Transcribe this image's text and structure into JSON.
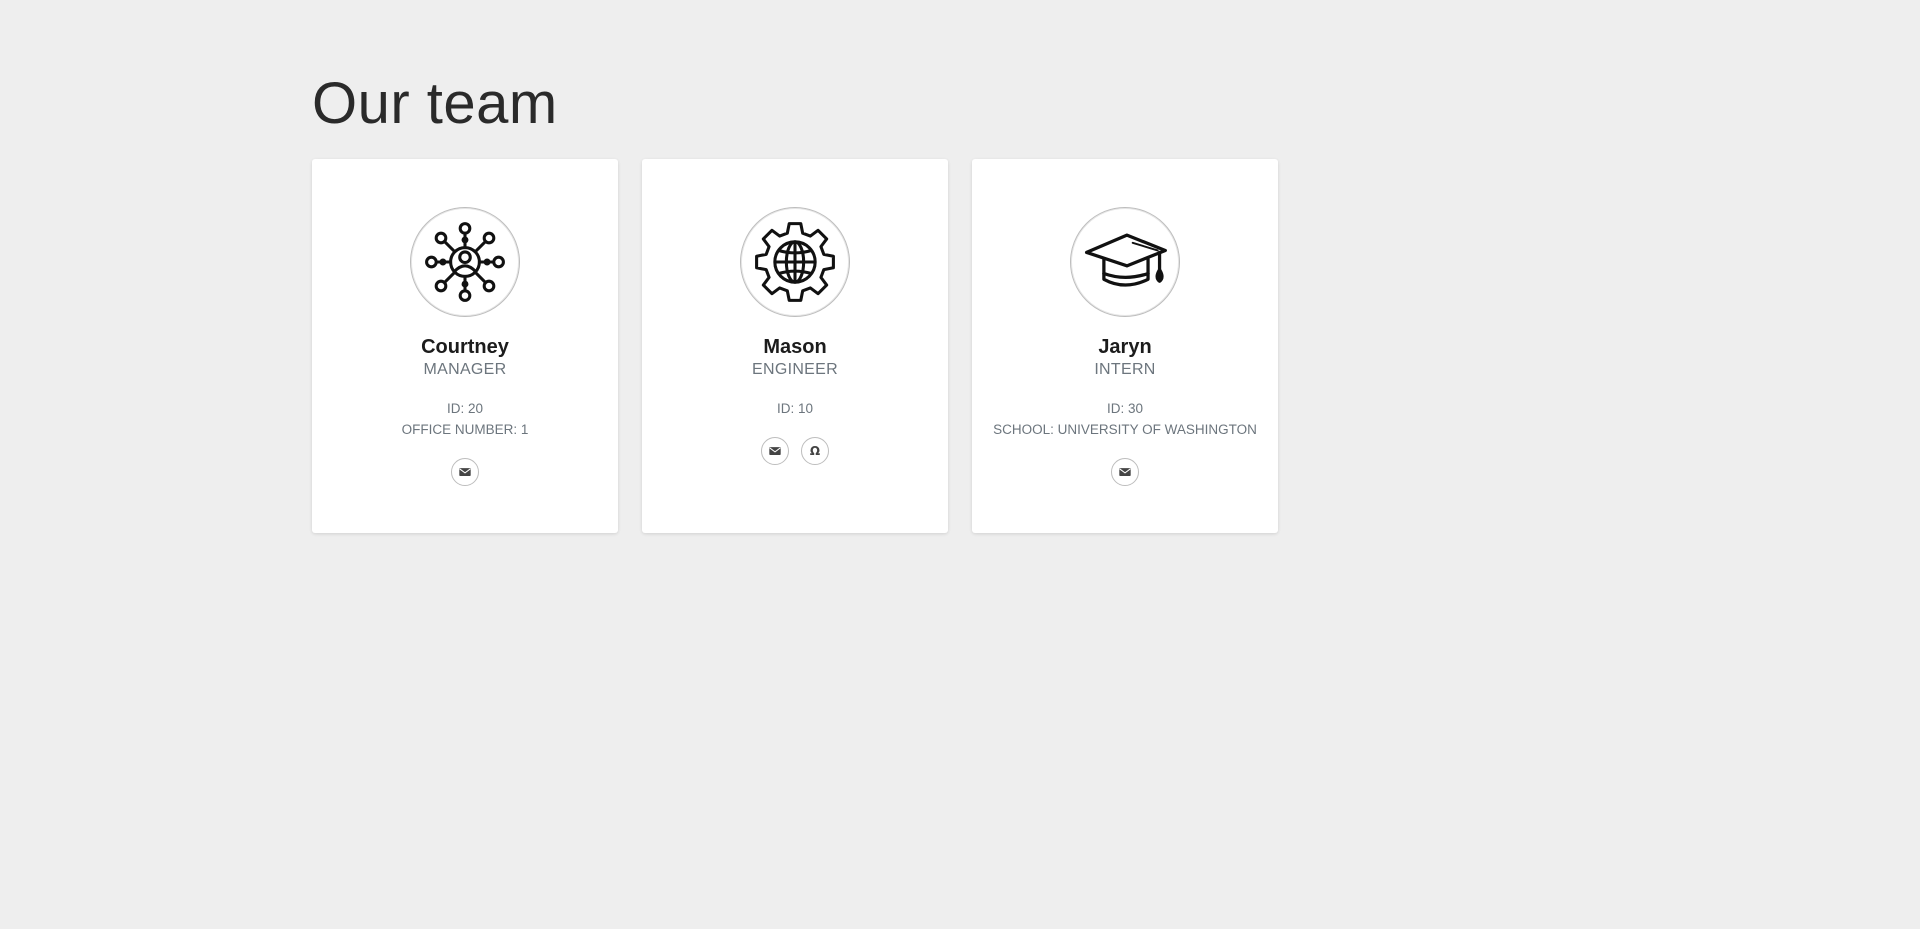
{
  "page": {
    "title": "Our team"
  },
  "team": [
    {
      "name": "Courtney",
      "role": "MANAGER",
      "icon": "network-person-icon",
      "details": [
        "ID: 20",
        "OFFICE NUMBER: 1"
      ],
      "actions": [
        "email"
      ]
    },
    {
      "name": "Mason",
      "role": "ENGINEER",
      "icon": "gear-globe-icon",
      "details": [
        "ID: 10"
      ],
      "actions": [
        "email",
        "github"
      ]
    },
    {
      "name": "Jaryn",
      "role": "INTERN",
      "icon": "graduation-cap-icon",
      "details": [
        "ID: 30",
        "SCHOOL: UNIVERSITY OF WASHINGTON"
      ],
      "actions": [
        "email"
      ]
    }
  ],
  "colors": {
    "background": "#eeeeee",
    "card": "#ffffff",
    "muted_text": "#6c757d",
    "icon": "#111111"
  }
}
